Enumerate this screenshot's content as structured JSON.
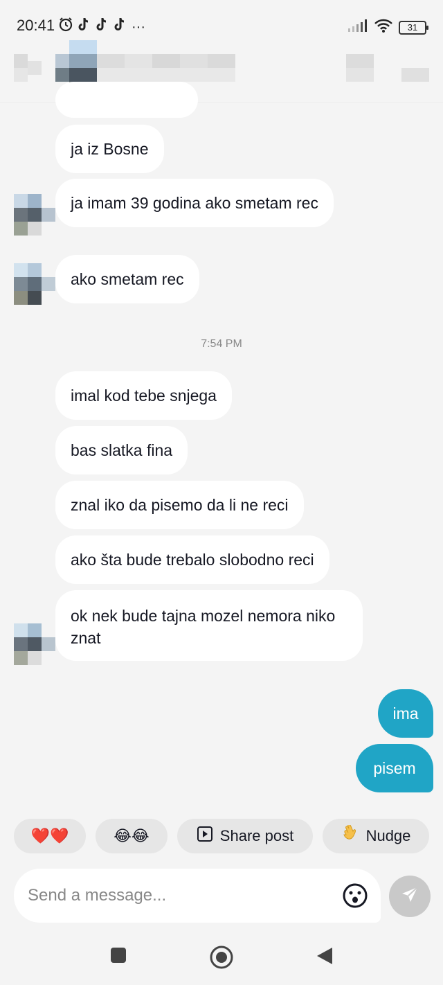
{
  "status_bar": {
    "time": "20:41",
    "icons": [
      "alarm-icon",
      "tiktok-icon",
      "tiktok-icon",
      "tiktok-icon"
    ],
    "more": "···",
    "battery": "31"
  },
  "messages_in": [
    {
      "text": "ja iz Bosne"
    },
    {
      "text": "ja imam 39 godina ako smetam rec"
    },
    {
      "text": "ako smetam rec"
    }
  ],
  "timestamp": "7:54 PM",
  "messages_in_2": [
    {
      "text": "imal kod tebe snjega"
    },
    {
      "text": "bas slatka fina"
    },
    {
      "text": "znal iko da pisemo da li ne reci"
    },
    {
      "text": "ako šta bude trebalo slobodno reci"
    },
    {
      "text": "ok nek bude tajna mozel nemora niko znat"
    }
  ],
  "messages_out": [
    {
      "text": "ima"
    },
    {
      "text": "pisem"
    }
  ],
  "quick_replies": {
    "hearts": "❤️❤️",
    "laugh": "😂😂",
    "share_post": "Share post",
    "nudge": "Nudge"
  },
  "composer": {
    "placeholder": "Send a message..."
  },
  "colors": {
    "outgoing_bubble": "#20a5c6",
    "incoming_bubble": "#ffffff",
    "background": "#f4f4f4"
  }
}
